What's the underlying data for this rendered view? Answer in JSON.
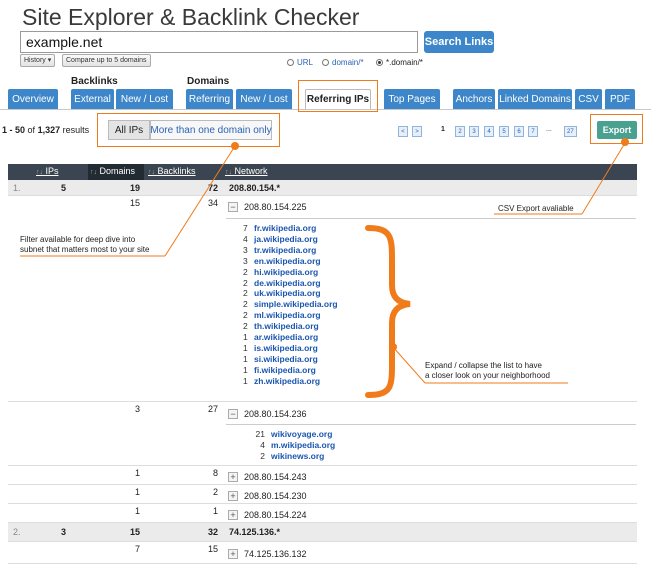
{
  "header": {
    "title": "Site Explorer & Backlink Checker"
  },
  "search": {
    "value": "example.net",
    "button": "Search Links"
  },
  "options": {
    "history": "History ▾",
    "compare": "Compare up to 5 domains",
    "modes": [
      {
        "label": "URL",
        "selected": false
      },
      {
        "label": "domain/*",
        "selected": false
      },
      {
        "label": "*.domain/*",
        "selected": true
      }
    ]
  },
  "tabs": {
    "group_backlinks": "Backlinks",
    "group_domains": "Domains",
    "items": [
      "Overview",
      "External",
      "New / Lost",
      "Referring",
      "New / Lost",
      "Referring IPs",
      "Top Pages",
      "Anchors",
      "Linked Domains",
      "CSV",
      "PDF"
    ],
    "active": "Referring IPs"
  },
  "results": {
    "range": "1 - 50",
    "of": "of",
    "total": "1,327",
    "suffix": "results"
  },
  "filters": {
    "all_ips": "All IPs",
    "multi": "More than one domain only"
  },
  "pagination": {
    "prev": "<",
    "next": ">",
    "current": "1",
    "pages": [
      "2",
      "3",
      "4",
      "5",
      "6",
      "7"
    ],
    "ellipsis": "...",
    "last": "27"
  },
  "export": {
    "label": "Export"
  },
  "table": {
    "headers": {
      "ips": "IPs",
      "domains": "Domains",
      "backlinks": "Backlinks",
      "network": "Network"
    },
    "sort_glyph": "↑↓"
  },
  "rows": [
    {
      "rank": "1.",
      "ips": "5",
      "domains": "19",
      "backlinks": "72",
      "network": "208.80.154.*"
    },
    {
      "domains": "15",
      "backlinks": "34",
      "toggle": "−",
      "network": "208.80.154.225"
    },
    {
      "domains": "3",
      "backlinks": "27",
      "toggle": "−",
      "network": "208.80.154.236"
    },
    {
      "domains": "1",
      "backlinks": "8",
      "toggle": "+",
      "network": "208.80.154.243"
    },
    {
      "domains": "1",
      "backlinks": "2",
      "toggle": "+",
      "network": "208.80.154.230"
    },
    {
      "domains": "1",
      "backlinks": "1",
      "toggle": "+",
      "network": "208.80.154.224"
    },
    {
      "rank": "2.",
      "ips": "3",
      "domains": "15",
      "backlinks": "32",
      "network": "74.125.136.*"
    },
    {
      "domains": "7",
      "backlinks": "15",
      "toggle": "+",
      "network": "74.125.136.132"
    }
  ],
  "list1": [
    {
      "n": "7",
      "d": "fr.wikipedia.org"
    },
    {
      "n": "4",
      "d": "ja.wikipedia.org"
    },
    {
      "n": "3",
      "d": "tr.wikipedia.org"
    },
    {
      "n": "3",
      "d": "en.wikipedia.org"
    },
    {
      "n": "2",
      "d": "hi.wikipedia.org"
    },
    {
      "n": "2",
      "d": "de.wikipedia.org"
    },
    {
      "n": "2",
      "d": "uk.wikipedia.org"
    },
    {
      "n": "2",
      "d": "simple.wikipedia.org"
    },
    {
      "n": "2",
      "d": "ml.wikipedia.org"
    },
    {
      "n": "2",
      "d": "th.wikipedia.org"
    },
    {
      "n": "1",
      "d": "ar.wikipedia.org"
    },
    {
      "n": "1",
      "d": "is.wikipedia.org"
    },
    {
      "n": "1",
      "d": "si.wikipedia.org"
    },
    {
      "n": "1",
      "d": "fi.wikipedia.org"
    },
    {
      "n": "1",
      "d": "zh.wikipedia.org"
    }
  ],
  "list2": [
    {
      "n": "21",
      "d": "wikivoyage.org"
    },
    {
      "n": "4",
      "d": "m.wikipedia.org"
    },
    {
      "n": "2",
      "d": "wikinews.org"
    }
  ],
  "annotations": {
    "csv": "CSV Export avaliable",
    "filter_1": "Filter available for deep dive into",
    "filter_2": "subnet that matters most to your site",
    "expand_1": "Expand / collapse the list to have",
    "expand_2": "a closer look on your neighborhood"
  },
  "colors": {
    "accent": "#3c86c9",
    "annotation": "#f07b1a",
    "export": "#4aa18f",
    "link": "#1a56b0",
    "header": "#3b4551"
  }
}
